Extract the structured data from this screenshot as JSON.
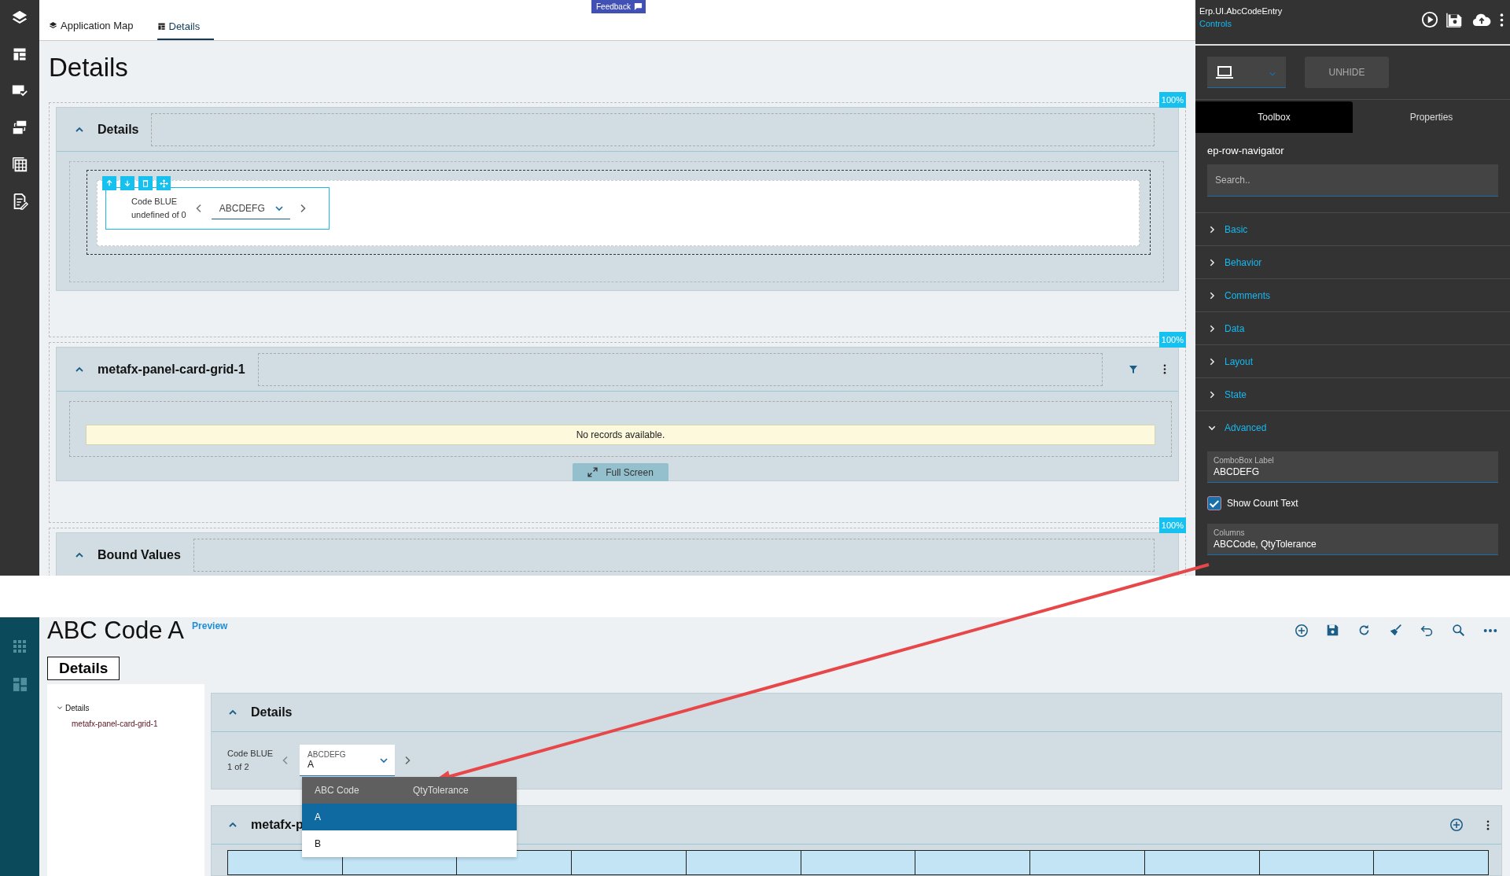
{
  "designer": {
    "tabs": [
      {
        "label": "Application Map",
        "selected": false
      },
      {
        "label": "Details",
        "selected": true
      }
    ],
    "feedback": "Feedback",
    "title": "Details",
    "panels": [
      {
        "kind": "navigator",
        "title": "Details",
        "scale": "100%",
        "navigator": {
          "label": "Code BLUE",
          "count": "undefined of 0",
          "combo_value": "ABCDEFG"
        }
      },
      {
        "kind": "grid",
        "title": "metafx-panel-card-grid-1",
        "scale": "100%",
        "empty_message": "No records available.",
        "fullscreen": "Full Screen"
      },
      {
        "kind": "bound",
        "title": "Bound Values",
        "scale": "100%"
      }
    ],
    "side_panel": {
      "app_name": "Erp.UI.AbcCodeEntry",
      "link": "Controls",
      "unhide": "UNHIDE",
      "tabs": [
        {
          "label": "Toolbox",
          "selected": true
        },
        {
          "label": "Properties",
          "selected": false
        }
      ],
      "component": "ep-row-navigator",
      "search": {
        "placeholder": "Search.."
      },
      "sections": [
        {
          "label": "Basic",
          "expanded": false
        },
        {
          "label": "Behavior",
          "expanded": false
        },
        {
          "label": "Comments",
          "expanded": false
        },
        {
          "label": "Data",
          "expanded": false
        },
        {
          "label": "Layout",
          "expanded": false
        },
        {
          "label": "State",
          "expanded": false
        },
        {
          "label": "Advanced",
          "expanded": true
        }
      ],
      "fields": [
        {
          "kind": "text",
          "label": "ComboBox Label",
          "value": "ABCDEFG"
        },
        {
          "kind": "checkbox",
          "label": "Show Count Text",
          "checked": true
        },
        {
          "kind": "text",
          "label": "Columns",
          "value": "ABCCode, QtyTolerance"
        }
      ]
    }
  },
  "preview": {
    "title": "ABC Code A",
    "badge": "Preview",
    "tabs": [
      {
        "label": "Details",
        "selected": true
      }
    ],
    "tree": [
      {
        "label": "Details",
        "expanded": true,
        "children": [
          {
            "label": "metafx-panel-card-grid-1"
          }
        ]
      }
    ],
    "details": {
      "title": "Details",
      "label": "Code BLUE",
      "count": "1 of 2",
      "combo_label": "ABCDEFG",
      "combo_value": "A"
    },
    "dropdown": {
      "columns": [
        "ABC Code",
        "QtyTolerance"
      ],
      "rows": [
        {
          "abc_code": "A",
          "selected": true
        },
        {
          "abc_code": "B",
          "selected": false
        }
      ]
    },
    "grid": {
      "title": "metafx-p"
    }
  }
}
